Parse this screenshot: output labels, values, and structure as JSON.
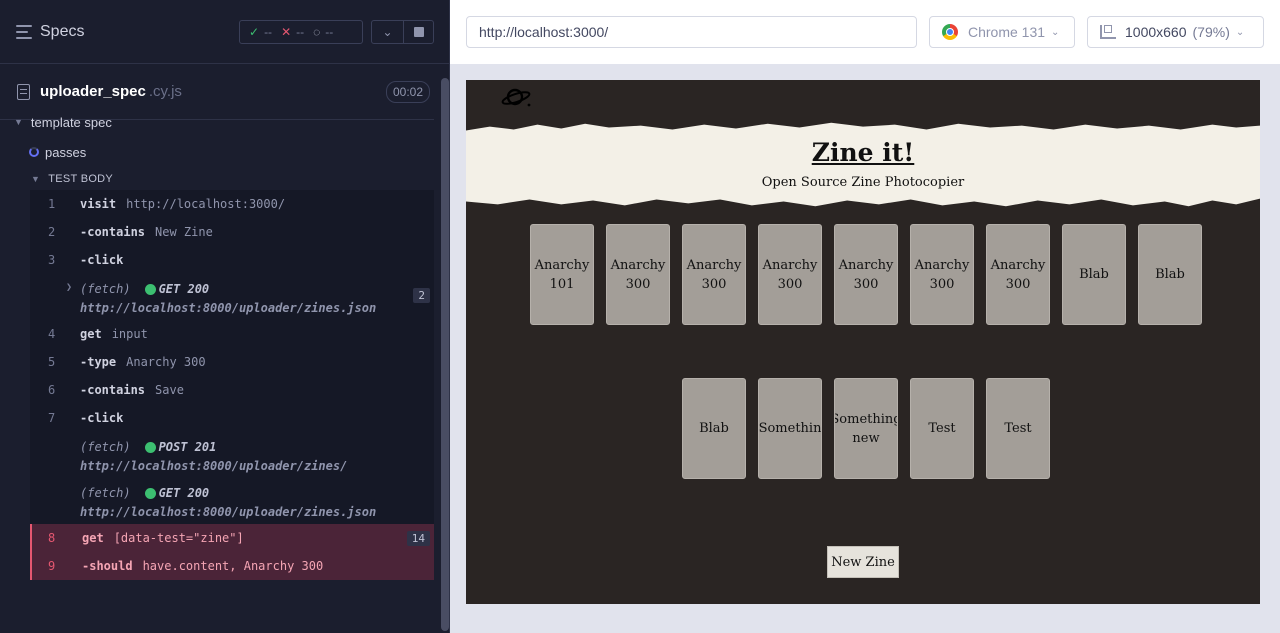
{
  "reporter": {
    "title": "Specs",
    "stats": {
      "passed": "--",
      "failed": "--",
      "pending": "--"
    },
    "file": {
      "name": "uploader_spec",
      "ext": ".cy.js",
      "duration": "00:02"
    },
    "suite": "template spec",
    "test": "passes",
    "test_body": "TEST BODY",
    "commands": [
      {
        "num": "1",
        "name": "visit",
        "arg": "http://localhost:3000/"
      },
      {
        "num": "2",
        "name": "-contains",
        "arg": "New Zine"
      },
      {
        "num": "3",
        "name": "-click",
        "arg": ""
      },
      {
        "fetch": "(fetch)",
        "req": "GET 200",
        "url": "http://localhost:8000/uploader/zines.json",
        "count": "2"
      },
      {
        "num": "4",
        "name": "get",
        "arg": "input"
      },
      {
        "num": "5",
        "name": "-type",
        "arg": "Anarchy 300"
      },
      {
        "num": "6",
        "name": "-contains",
        "arg": "Save"
      },
      {
        "num": "7",
        "name": "-click",
        "arg": ""
      },
      {
        "fetch": "(fetch)",
        "req": "POST 201",
        "url": "http://localhost:8000/uploader/zines/"
      },
      {
        "fetch": "(fetch)",
        "req": "GET 200",
        "url": "http://localhost:8000/uploader/zines.json"
      },
      {
        "num": "8",
        "name": "get",
        "arg": "[data-test=\"zine\"]",
        "count": "14"
      },
      {
        "num": "9",
        "name": "-should",
        "arg": "have.content, Anarchy 300"
      }
    ]
  },
  "topbar": {
    "url": "http://localhost:3000/",
    "browser": "Chrome 131",
    "viewport": "1000x660",
    "viewport_pct": "(79%)"
  },
  "app": {
    "title": "Zine it!",
    "subtitle": "Open Source Zine Photocopier",
    "zines": [
      "Anarchy\n101",
      "Anarchy\n300",
      "Anarchy\n300",
      "Anarchy\n300",
      "Anarchy\n300",
      "Anarchy\n300",
      "Anarchy\n300",
      "Blab",
      "Blab",
      "Blab",
      "Somethin",
      "Something\nnew",
      "Test",
      "Test"
    ],
    "new_zine": "New Zine"
  },
  "colors": {
    "pass": "#3cbf71",
    "fail": "#e45770",
    "accent": "#6470f3",
    "app_bg": "#2a2523"
  }
}
